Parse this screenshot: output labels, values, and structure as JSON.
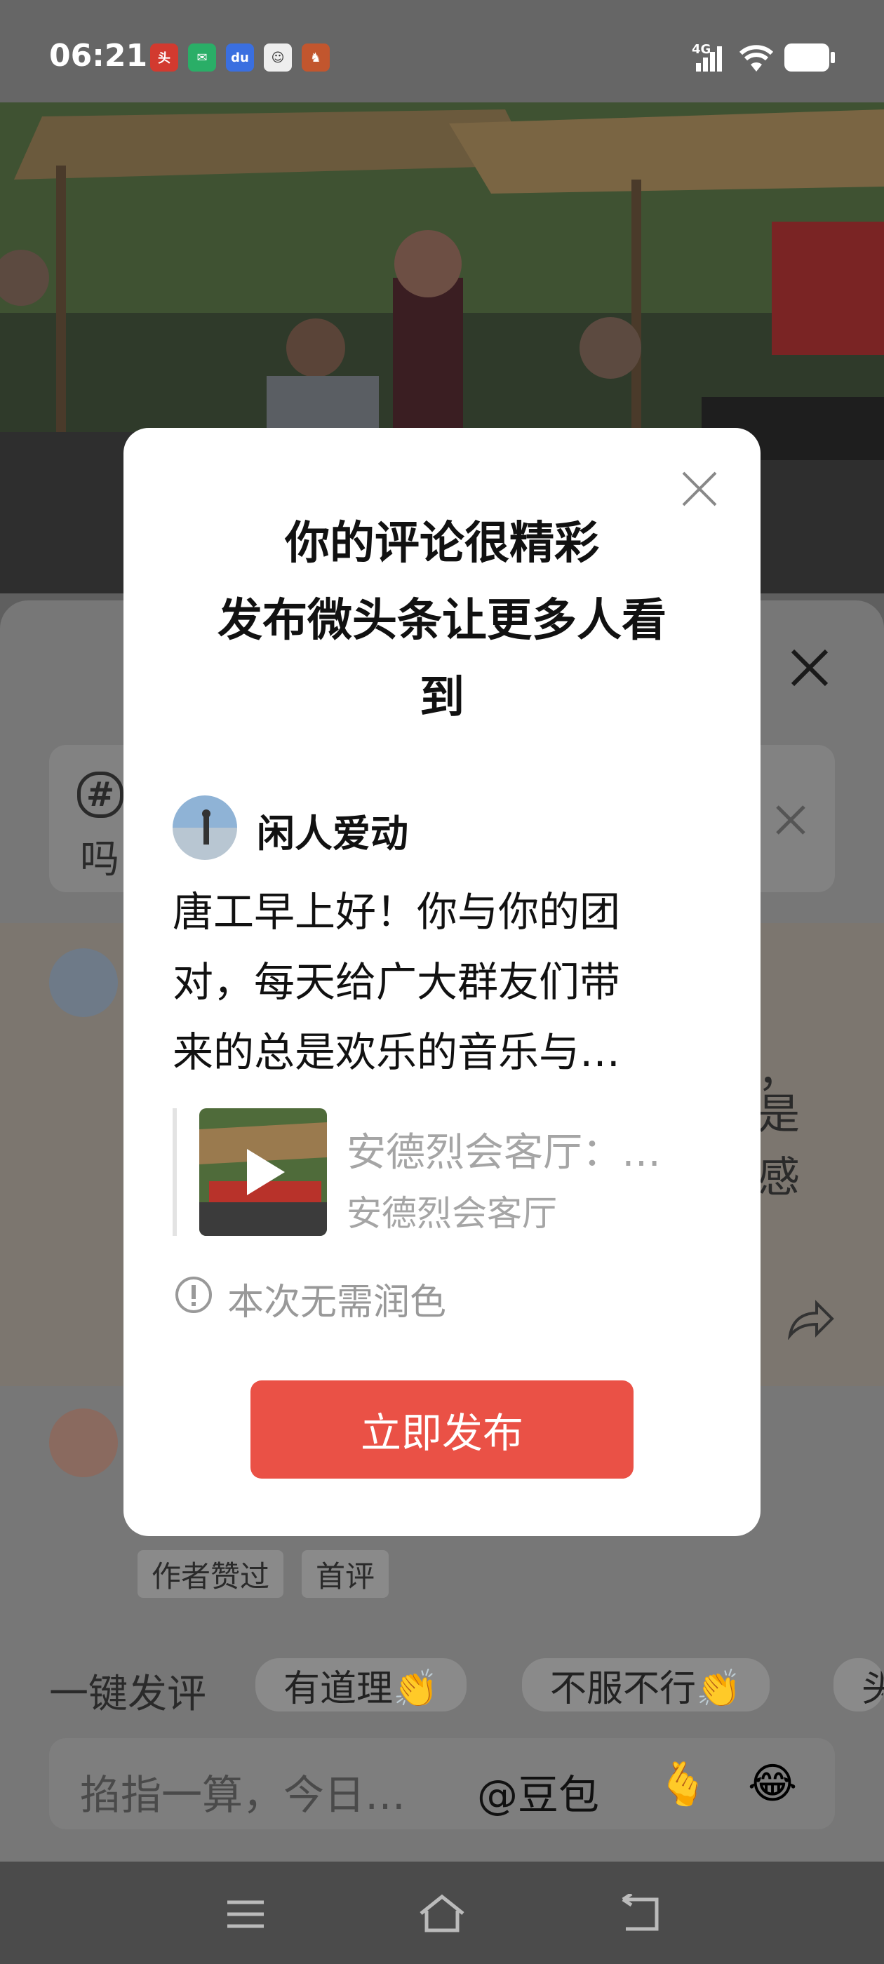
{
  "status_bar": {
    "time": "06:21",
    "network": "4G",
    "app_icons": [
      "toutiao-icon",
      "wechat-icon",
      "baidu-icon",
      "avatar-app-icon",
      "game-icon"
    ]
  },
  "background": {
    "comment_preview_line1": "#",
    "comment_preview_line2": "吗",
    "comment_tail_1": "，",
    "comment_tail_2": "是",
    "comment_tail_3": "感",
    "badges": [
      "作者赞过",
      "首评"
    ],
    "quick_label": "一键发评",
    "quick_chips": [
      "有道理👏",
      "不服不行👏",
      "头"
    ],
    "input_placeholder": "掐指一算，今日…",
    "mention": "@豆包",
    "emoji_1": "🫰",
    "emoji_2": "😂"
  },
  "modal": {
    "title_line1": "你的评论很精彩",
    "title_line2": "发布微头条让更多人看",
    "title_line3": "到",
    "user_name": "闲人爱动",
    "body_line1": "唐工早上好！你与你的团",
    "body_line2": "对，每天给广大群友们带",
    "body_line3": "来的总是欢乐的音乐与…",
    "video_title": "安德烈会客厅：…",
    "video_author": "安德烈会客厅",
    "hint": "本次无需润色",
    "publish_label": "立即发布"
  },
  "colors": {
    "accent": "#ea5146",
    "overlay": "#5f5f5f",
    "modal_bg": "#ffffff"
  }
}
